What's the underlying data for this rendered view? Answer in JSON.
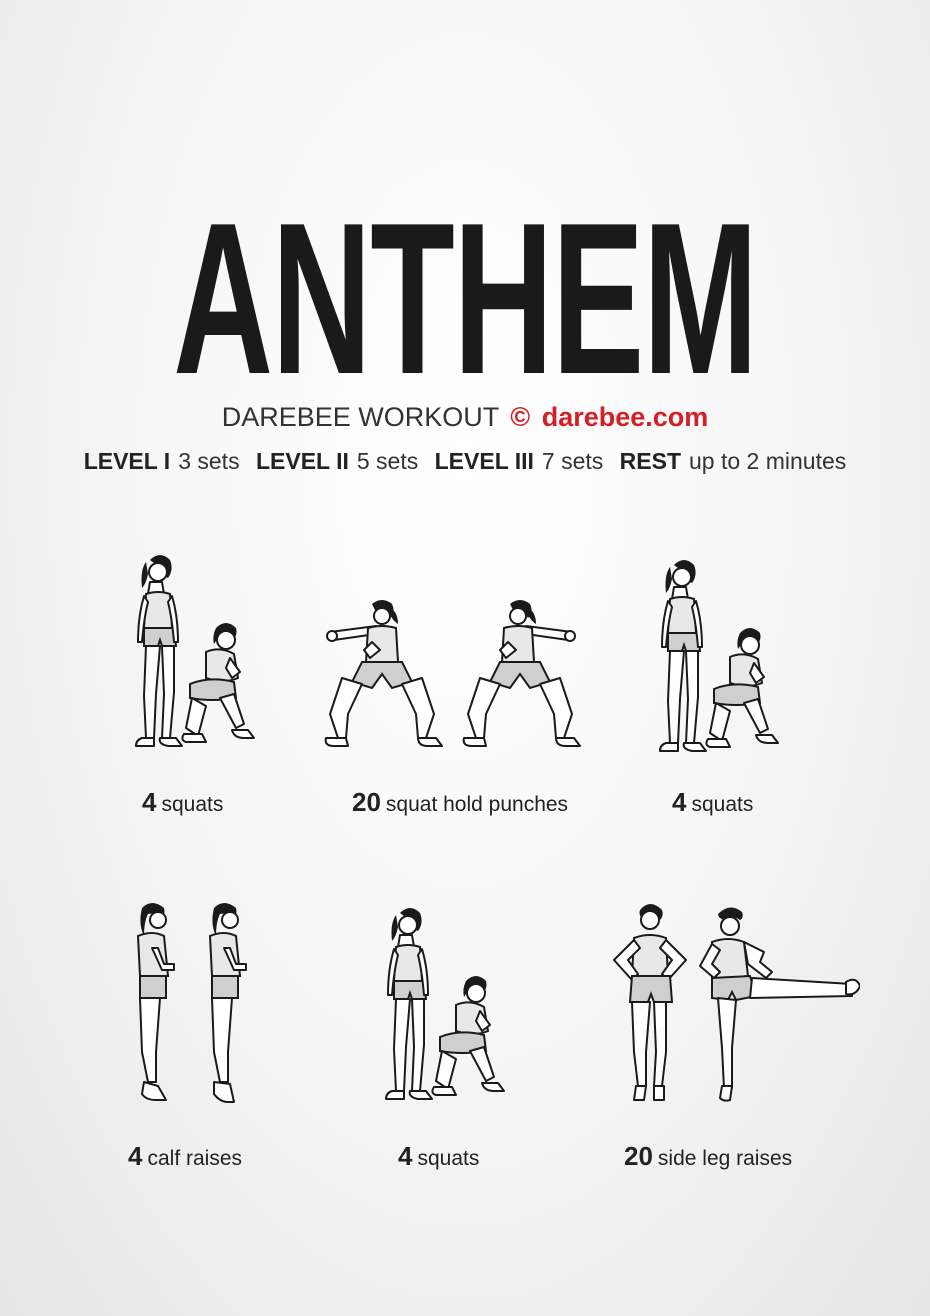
{
  "title": "ANTHEM",
  "brand": {
    "label": "DAREBEE WORKOUT",
    "copyright_symbol": "©",
    "site": "darebee.com",
    "accent_color": "#d31f26"
  },
  "levels": [
    {
      "label": "LEVEL I",
      "value": "3 sets"
    },
    {
      "label": "LEVEL II",
      "value": "5 sets"
    },
    {
      "label": "LEVEL III",
      "value": "7 sets"
    },
    {
      "label": "REST",
      "value": "up to 2 minutes"
    }
  ],
  "exercises": [
    {
      "count": "4",
      "name": "squats",
      "figure": "squat"
    },
    {
      "count": "20",
      "name": "squat hold punches",
      "figure": "squat-hold-punch"
    },
    {
      "count": "4",
      "name": "squats",
      "figure": "squat"
    },
    {
      "count": "4",
      "name": "calf raises",
      "figure": "calf-raise"
    },
    {
      "count": "4",
      "name": "squats",
      "figure": "squat"
    },
    {
      "count": "20",
      "name": "side leg raises",
      "figure": "side-leg-raise"
    }
  ]
}
